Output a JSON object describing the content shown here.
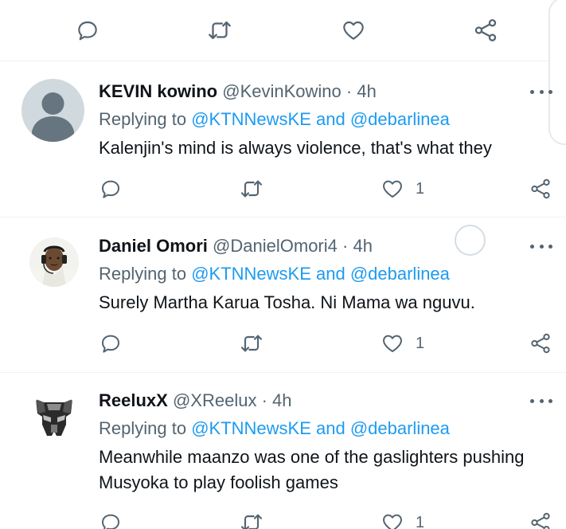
{
  "top_actions": {
    "reply_icon": "reply-icon",
    "retweet_icon": "retweet-icon",
    "like_icon": "heart-icon",
    "share_icon": "share-icon"
  },
  "tweets": [
    {
      "name": "KEVIN kowino",
      "handle": "@KevinKowino",
      "separator": "·",
      "time": "4h",
      "replying_prefix": "Replying to",
      "replying_to": "@KTNNewsKE and @debarlinea",
      "text": "Kalenjin's mind is always violence, that's what they",
      "like_count": "1",
      "avatar": "default-avatar"
    },
    {
      "name": "Daniel Omori",
      "handle": "@DanielOmori4",
      "separator": "·",
      "time": "4h",
      "replying_prefix": "Replying to",
      "replying_to": "@KTNNewsKE and @debarlinea",
      "text": "Surely Martha Karua Tosha. Ni Mama wa nguvu.",
      "like_count": "1",
      "avatar": "photo-avatar"
    },
    {
      "name": "ReeluxX",
      "handle": "@XReelux",
      "separator": "·",
      "time": "4h",
      "replying_prefix": "Replying to",
      "replying_to": "@KTNNewsKE and @debarlinea",
      "text": "Meanwhile maanzo was one of the gaslighters pushing Musyoka to play foolish games",
      "like_count": "1",
      "avatar": "autobot-avatar"
    }
  ],
  "colors": {
    "link": "#1d9bf0",
    "secondary_text": "#536471",
    "primary_text": "#0f1419",
    "divider": "#eff3f4"
  }
}
